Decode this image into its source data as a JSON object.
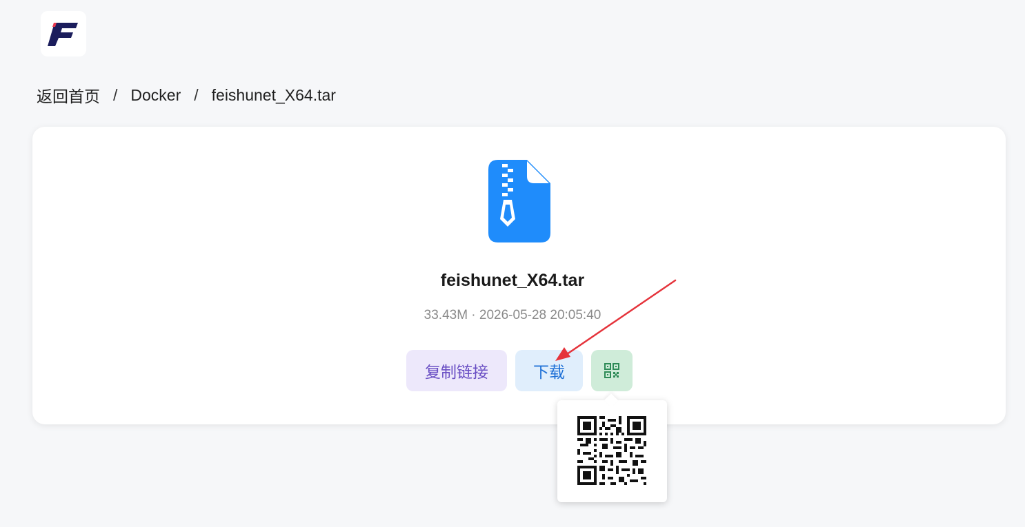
{
  "logo": {
    "text": "F",
    "brand_color": "#1b1d5c",
    "accent_color": "#e53950"
  },
  "breadcrumb": {
    "items": [
      {
        "label": "返回首页"
      },
      {
        "label": "Docker"
      },
      {
        "label": "feishunet_X64.tar"
      }
    ],
    "separator": "/"
  },
  "file": {
    "icon": "zip-file-icon",
    "icon_color": "#1f8cfb",
    "name": "feishunet_X64.tar",
    "meta": "33.43M · 2026-05-28 20:05:40"
  },
  "actions": {
    "copy_link_label": "复制链接",
    "download_label": "下载",
    "qr_icon": "qr-code-icon"
  },
  "qr_popover": {
    "visible": true,
    "content": "qr-code-image"
  },
  "annotation": {
    "type": "arrow",
    "color": "#e5333b"
  }
}
